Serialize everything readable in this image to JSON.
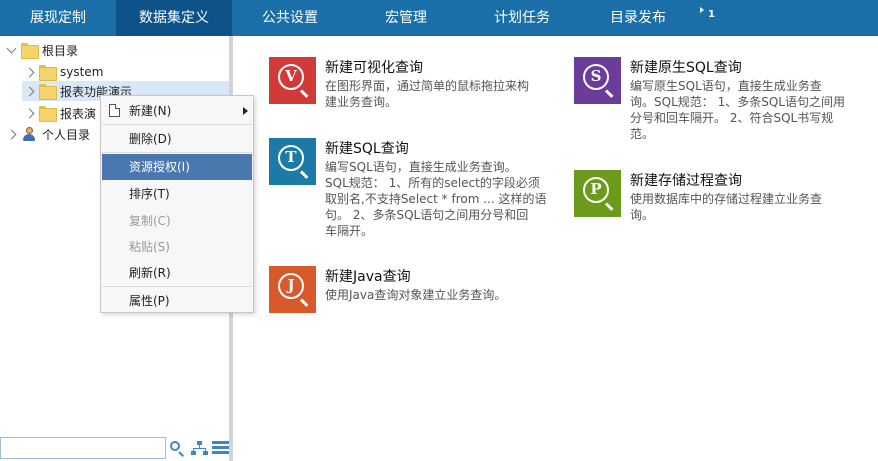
{
  "topnav": {
    "items": [
      {
        "label": "展现定制"
      },
      {
        "label": "数据集定义"
      },
      {
        "label": "公共设置"
      },
      {
        "label": "宏管理"
      },
      {
        "label": "计划任务"
      },
      {
        "label": "目录发布"
      }
    ],
    "active_index": 1,
    "more_count": "1"
  },
  "tree": {
    "root": "根目录",
    "children": [
      "system",
      "报表功能演示",
      "报表演"
    ],
    "personal": "个人目录"
  },
  "context_menu": {
    "items": [
      {
        "label": "新建(N)",
        "disabled": false
      },
      {
        "label": "删除(D)",
        "disabled": false
      },
      {
        "label": "资源授权(I)",
        "disabled": false
      },
      {
        "label": "排序(T)",
        "disabled": false
      },
      {
        "label": "复制(C)",
        "disabled": true
      },
      {
        "label": "粘贴(S)",
        "disabled": true
      },
      {
        "label": "刷新(R)",
        "disabled": false
      },
      {
        "label": "属性(P)",
        "disabled": false
      }
    ],
    "highlighted_index": 2
  },
  "search": {
    "value": "",
    "placeholder": ""
  },
  "cards": [
    {
      "letter": "V",
      "color": "#d23a3a",
      "title": "新建可视化查询",
      "desc": [
        "在图形界面，通过简单的鼠标拖拉来构",
        "建业务查询。"
      ]
    },
    {
      "letter": "S",
      "color": "#6b3c99",
      "title": "新建原生SQL查询",
      "desc": [
        "编写原生SQL语句，直接生成业务查",
        "询。SQL规范： 1、多条SQL语句之间用",
        "分号和回车隔开。 2、符合SQL书写规",
        "范。"
      ]
    },
    {
      "letter": "T",
      "color": "#1d7aa6",
      "title": "新建SQL查询",
      "desc": [
        "编写SQL语句，直接生成业务查询。",
        "SQL规范： 1、所有的select的字段必须",
        "取别名,不支持Select * from ... 这样的语",
        "句。 2、多条SQL语句之间用分号和回",
        "车隔开。"
      ]
    },
    {
      "letter": "P",
      "color": "#6c9a1a",
      "title": "新建存储过程查询",
      "desc": [
        "使用数据库中的存储过程建立业务查",
        "询。"
      ]
    },
    {
      "letter": "J",
      "color": "#d8592a",
      "title": "新建Java查询",
      "desc": [
        "使用Java查询对象建立业务查询。"
      ]
    }
  ]
}
